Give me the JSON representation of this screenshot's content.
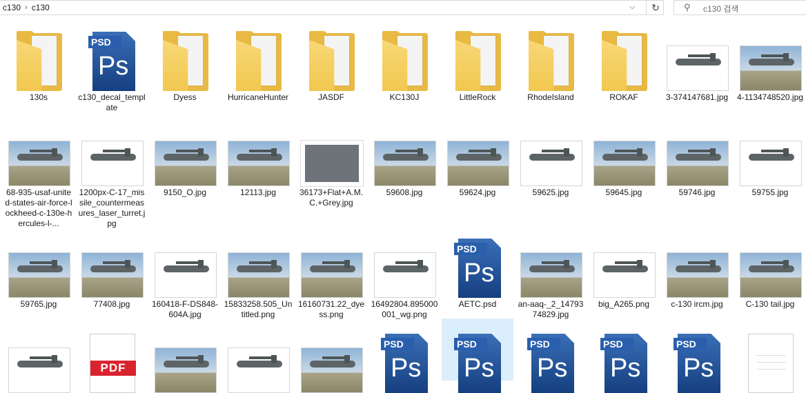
{
  "address": {
    "crumbs": [
      "c130",
      "c130"
    ]
  },
  "search": {
    "placeholder": "c130 검색"
  },
  "items": [
    {
      "label": "130s",
      "kind": "folder"
    },
    {
      "label": "c130_decal_template",
      "kind": "psd"
    },
    {
      "label": "Dyess",
      "kind": "folder"
    },
    {
      "label": "HurricaneHunter",
      "kind": "folder"
    },
    {
      "label": "JASDF",
      "kind": "folder"
    },
    {
      "label": "KC130J",
      "kind": "folder"
    },
    {
      "label": "LittleRock",
      "kind": "folder"
    },
    {
      "label": "RhodeIsland",
      "kind": "folder"
    },
    {
      "label": "ROKAF",
      "kind": "folder"
    },
    {
      "label": "3-374147681.jpg",
      "kind": "image"
    },
    {
      "label": "4-1134748520.jpg",
      "kind": "image"
    },
    {
      "label": "68-935-usaf-united-states-air-force-lockheed-c-130e-hercules-l-...",
      "kind": "image"
    },
    {
      "label": "1200px-C-17_missile_countermeasures_laser_turret.jpg",
      "kind": "image"
    },
    {
      "label": "9150_O.jpg",
      "kind": "image"
    },
    {
      "label": "12113.jpg",
      "kind": "image"
    },
    {
      "label": "36173+Flat+A.M.C.+Grey.jpg",
      "kind": "grey"
    },
    {
      "label": "59608.jpg",
      "kind": "image"
    },
    {
      "label": "59624.jpg",
      "kind": "image"
    },
    {
      "label": "59625.jpg",
      "kind": "image"
    },
    {
      "label": "59645.jpg",
      "kind": "image"
    },
    {
      "label": "59746.jpg",
      "kind": "image"
    },
    {
      "label": "59755.jpg",
      "kind": "image"
    },
    {
      "label": "59765.jpg",
      "kind": "image"
    },
    {
      "label": "77408.jpg",
      "kind": "image"
    },
    {
      "label": "160418-F-DS848-604A.jpg",
      "kind": "image"
    },
    {
      "label": "15833258.505_Untitled.png",
      "kind": "image"
    },
    {
      "label": "16160731.22_dyess.png",
      "kind": "image"
    },
    {
      "label": "16492804.895000001_wg.png",
      "kind": "image"
    },
    {
      "label": "AETC.psd",
      "kind": "psd"
    },
    {
      "label": "an-aaq-_2_1479374829.jpg",
      "kind": "image"
    },
    {
      "label": "big_A265.png",
      "kind": "image"
    },
    {
      "label": "c-130 ircm.jpg",
      "kind": "image"
    },
    {
      "label": "C-130 tail.jpg",
      "kind": "image"
    },
    {
      "label": "",
      "kind": "image"
    },
    {
      "label": "",
      "kind": "pdf"
    },
    {
      "label": "",
      "kind": "image"
    },
    {
      "label": "",
      "kind": "image"
    },
    {
      "label": "",
      "kind": "image"
    },
    {
      "label": "",
      "kind": "psd"
    },
    {
      "label": "",
      "kind": "psd",
      "selected": true
    },
    {
      "label": "",
      "kind": "psd"
    },
    {
      "label": "",
      "kind": "psd"
    },
    {
      "label": "",
      "kind": "psd"
    },
    {
      "label": "",
      "kind": "blank"
    }
  ],
  "icons": {
    "dropdown": "chevron-down-icon",
    "refresh": "refresh-icon",
    "search": "search-icon"
  },
  "psd_text": {
    "tag": "PSD",
    "mark": "Ps"
  },
  "pdf_text": {
    "tag": "PDF"
  }
}
